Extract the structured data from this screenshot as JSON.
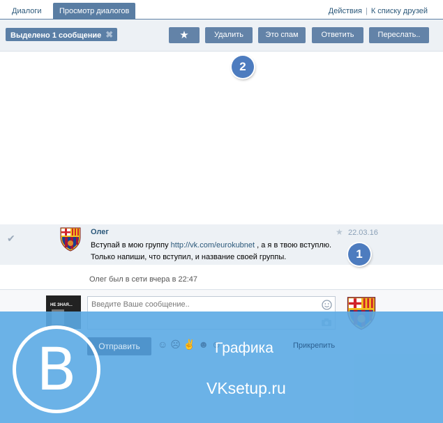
{
  "tabs": {
    "dialogs": "Диалоги",
    "view": "Просмотр диалогов",
    "actions": "Действия",
    "separator": "|",
    "to_friends": "К списку друзей"
  },
  "toolbar": {
    "selected": "Выделено 1 сообщение",
    "close": "✖",
    "star": "★",
    "delete": "Удалить",
    "spam": "Это спам",
    "reply": "Ответить",
    "forward": "Переслать.."
  },
  "markers": {
    "one": "1",
    "two": "2"
  },
  "message": {
    "author": "Олег",
    "date": "22.03.16",
    "text_before": "Вступай в мою группу ",
    "link": "http://vk.com/eurokubnet",
    "text_after": " , а я в твою вступлю. Только напиши, что вступил, и название своей группы."
  },
  "status": "Олег был в сети вчера в 22:47",
  "composer": {
    "placeholder": "Введите Ваше сообщение..",
    "send": "Отправить",
    "attach": "Прикрепить",
    "thumb_text": "НЕ ЗНАЯ...",
    "emoji_icons": "☺☹✌☻☺"
  },
  "overlay": {
    "graphics": "Графика",
    "site": "VKsetup.ru",
    "logo_letter": "B"
  },
  "colors": {
    "primary": "#597da3",
    "overlay": "#5baae4",
    "link": "#2b587a",
    "marker": "#4d7cbf"
  }
}
